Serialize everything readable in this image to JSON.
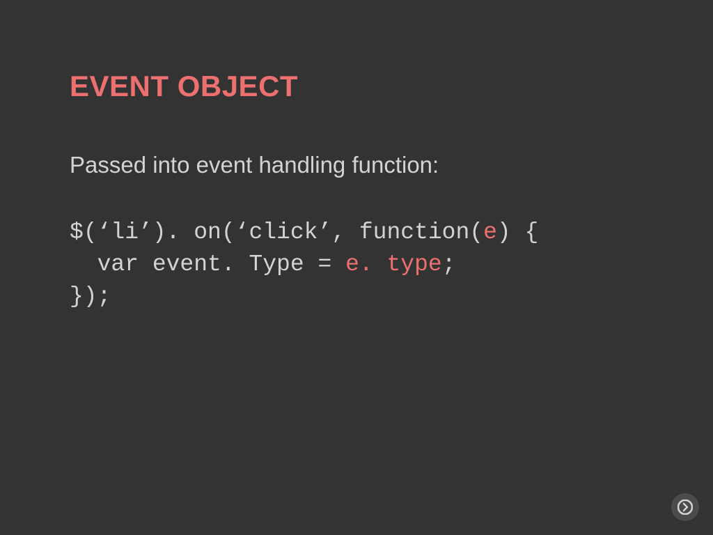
{
  "title": "EVENT OBJECT",
  "subtitle": "Passed into event handling function:",
  "code": {
    "l1a": "$(‘li’). on(‘click’, function(",
    "l1b": "e",
    "l1c": ") {",
    "l2a": "  var event. Type = ",
    "l2b": "e. type",
    "l2c": ";",
    "l3": "});"
  },
  "icons": {
    "next": "next-arrow-icon"
  }
}
